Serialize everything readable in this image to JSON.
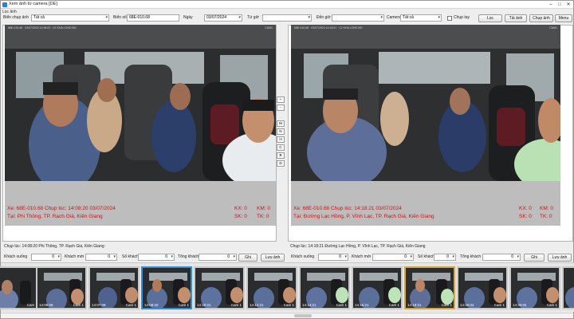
{
  "window": {
    "title": "Xem ảnh từ camera [DE]",
    "menu": "Lọc ảnh"
  },
  "filters": {
    "bien_chup_anh_label": "Biển chụp ảnh",
    "bien_chup_anh_value": "Tất cả",
    "bien_so_label": "Biển số",
    "bien_so_value": "68E-010.68",
    "ngay_label": "Ngày",
    "ngay_value": "03/07/2024",
    "tu_gio_label": "Từ giờ",
    "den_gio_label": "Đến giờ",
    "camera_label": "Camera",
    "camera_value": "Tất cả",
    "chup_tay_label": "Chụp tay",
    "loc_button": "Lọc",
    "tai_anh_button": "Tải ảnh",
    "chup_anh_button": "Chụp ảnh",
    "menu_button": "Menu"
  },
  "left_panel": {
    "osd_top": "68E-010.68 · 03/07/2024 14:08:20 · LE KHA LONG BG",
    "osd_cam": "CAM1",
    "xe_line": "Xe: 68E-010.68 Chụp lúc: 14:08:20 03/07/2024",
    "tai_line": "Tại: Phi Thông, TP. Rạch Giá, Kiên Giang",
    "kx": "KX: 0",
    "km": "KM: 0",
    "sk": "SK: 0",
    "tk": "TK: 0",
    "status": "Chụp lúc: 14:08:20 Phi Thông, TP. Rạch Giá, Kiên Giang"
  },
  "right_panel": {
    "osd_top": "68E-010.68 · 03/07/2024 14:18:21 · LE KHA LONG BG",
    "osd_cam": "CAM1",
    "xe_line": "Xe: 68E-010.68 Chụp lúc: 14:18:21 03/07/2024",
    "tai_line": "Tại: Đường Lạc Hồng, P. Vĩnh Lạc, TP. Rạch Giá, Kiên Giang",
    "kx": "KX: 0",
    "km": "KM: 0",
    "sk": "SK: 0",
    "tk": "TK: 0",
    "status": "Chụp lúc: 14:18:21 Đường Lạc Hồng, P. Vĩnh Lạc, TP. Rạch Giá, Kiên Giang"
  },
  "side_buttons": [
    "+",
    "-",
    "M",
    "N",
    "H",
    "C",
    "B",
    "D"
  ],
  "controls": {
    "khach_xuong": "Khách xuống",
    "khach_moi": "Khách mới",
    "so_khach": "Số khách",
    "tong_khach": "Tổng khách",
    "zero": "0",
    "ghi_button": "Ghi",
    "luu_anh_button": "Lưu ảnh"
  },
  "thumbnails": [
    {
      "time": "",
      "cam": "Cam 1",
      "state": "normal"
    },
    {
      "time": "14:05:08",
      "cam": "Cam 1",
      "state": "normal"
    },
    {
      "time": "14:07:08",
      "cam": "Cam 1",
      "state": "normal"
    },
    {
      "time": "14:08:20",
      "cam": "Cam 1",
      "state": "selected-left"
    },
    {
      "time": "14:10:21",
      "cam": "Cam 1",
      "state": "normal"
    },
    {
      "time": "14:12:21",
      "cam": "Cam 1",
      "state": "normal"
    },
    {
      "time": "14:14:21",
      "cam": "Cam 1",
      "state": "normal"
    },
    {
      "time": "14:16:21",
      "cam": "Cam 1",
      "state": "normal"
    },
    {
      "time": "14:18:21",
      "cam": "Cam 1",
      "state": "selected-right"
    },
    {
      "time": "14:20:04",
      "cam": "Cam 1",
      "state": "normal"
    },
    {
      "time": "14:30:04",
      "cam": "Cam 1",
      "state": "normal"
    }
  ]
}
